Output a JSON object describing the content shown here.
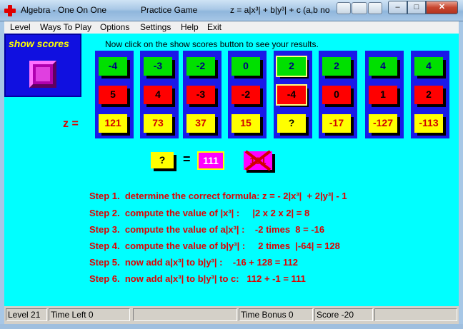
{
  "window": {
    "app_title": "Algebra - One On One",
    "mode": "Practice Game",
    "formula_hint": "z = a|x³| + b|y³| + c (a,b no",
    "controls": {
      "minimize": "–",
      "maximize": "□",
      "close": "✕"
    }
  },
  "menu": [
    "Level",
    "Ways To Play",
    "Options",
    "Settings",
    "Help",
    "Exit"
  ],
  "show_scores": {
    "label": "show scores"
  },
  "instruction": "Now click on the show scores button to see your results.",
  "z_label": "z =",
  "columns": [
    {
      "x": "-4",
      "y": "5",
      "z": "121"
    },
    {
      "x": "-3",
      "y": "4",
      "z": "73"
    },
    {
      "x": "-2",
      "y": "-3",
      "z": "37"
    },
    {
      "x": "0",
      "y": "-2",
      "z": "15"
    },
    {
      "x": "2",
      "y": "-4",
      "z": "?"
    },
    {
      "x": "2",
      "y": "0",
      "z": "-17"
    },
    {
      "x": "4",
      "y": "1",
      "z": "-127"
    },
    {
      "x": "4",
      "y": "2",
      "z": "-113"
    }
  ],
  "equation": {
    "question": "?",
    "equals": "=",
    "answer": "111",
    "wrong_answer": "101"
  },
  "steps": [
    "Step 1.  determine the correct formula: z = - 2|x³|  + 2|y³| - 1",
    "Step 2.  compute the value of |x³| :     |2 x 2 x 2| = 8",
    "Step 3.  compute the value of a|x³| :    -2 times  8 = -16",
    "Step 4.  compute the value of b|y³| :     2 times  |-64| = 128",
    "Step 5.  now add a|x³| to b|y³| :    -16 + 128 = 112",
    "Step 6.  now add a|x³| to b|y³| to c:   112 + -1 = 111"
  ],
  "status": {
    "level": "Level 21",
    "time_left": "Time Left 0",
    "blank1": "",
    "time_bonus": "Time Bonus 0",
    "score": "Score -20",
    "blank2": ""
  }
}
